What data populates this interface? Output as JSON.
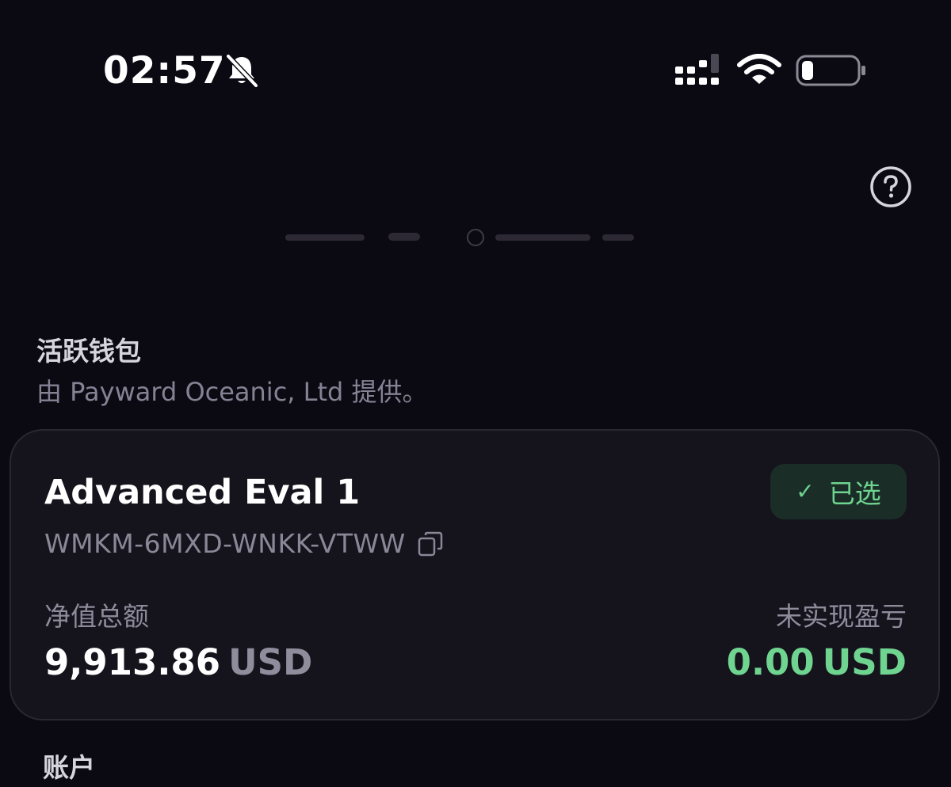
{
  "status_bar": {
    "time": "02:57",
    "icons": [
      "bell-slash-icon",
      "signal-icon",
      "wifi-icon",
      "battery-icon"
    ]
  },
  "header": {
    "help_icon": "question-circle-icon"
  },
  "active_wallet": {
    "title": "活跃钱包",
    "subtitle": "由 Payward Oceanic, Ltd 提供。"
  },
  "wallet_card": {
    "name": "Advanced Eval 1",
    "badge": "已选",
    "account_id": "WMKM-6MXD-WNKK-VTWW",
    "net_label": "净值总额",
    "net_amount": "9,913.86",
    "net_currency": "USD",
    "pnl_label": "未实现盈亏",
    "pnl_amount": "0.00",
    "pnl_currency": "USD"
  },
  "accounts": {
    "title": "账户"
  },
  "colors": {
    "background": "#0b0912",
    "card": "#15131c",
    "accent_green": "#6ed48f",
    "badge_bg": "#1a2e27",
    "muted_text": "#8a8797"
  }
}
